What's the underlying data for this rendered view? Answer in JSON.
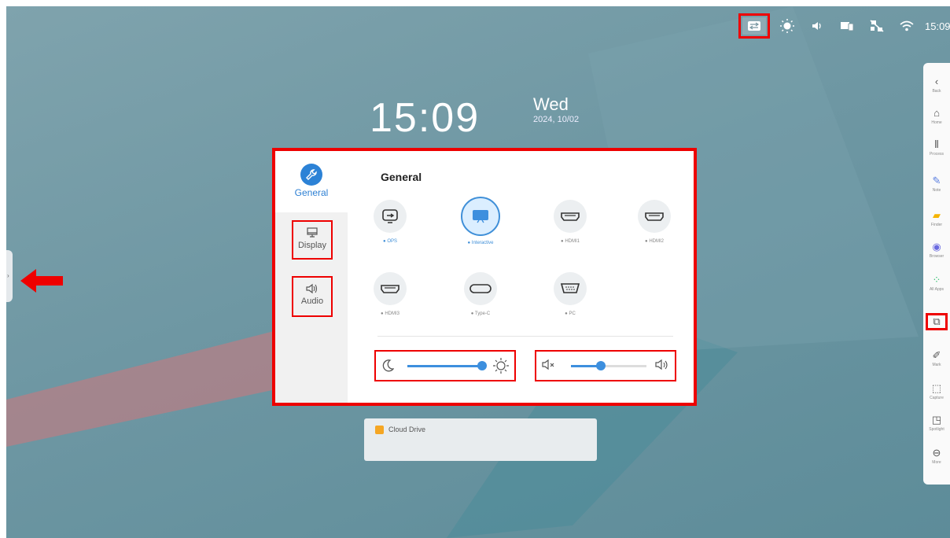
{
  "status_bar": {
    "time": "15:09",
    "icons": [
      "input-switch-icon",
      "brightness-icon",
      "volume-icon",
      "screen-share-icon",
      "network-off-icon",
      "wifi-icon"
    ]
  },
  "clock": {
    "time": "15:09",
    "day": "Wed",
    "date": "2024, 10/02"
  },
  "panel": {
    "title": "General",
    "sidebar": [
      {
        "label": "General",
        "icon": "wrench-icon",
        "active": true
      },
      {
        "label": "Display",
        "icon": "monitor-icon"
      },
      {
        "label": "Audio",
        "icon": "speaker-icon"
      }
    ],
    "sources": [
      {
        "label": "OPS",
        "icon": "ops-icon"
      },
      {
        "label": "Interactive",
        "icon": "interactive-icon",
        "active": true
      },
      {
        "label": "HDMI1",
        "icon": "hdmi-icon"
      },
      {
        "label": "HDMI2",
        "icon": "hdmi-icon"
      },
      {
        "label": "HDMI3",
        "icon": "hdmi-icon"
      },
      {
        "label": "Type-C",
        "icon": "type-c-icon"
      },
      {
        "label": "PC",
        "icon": "vga-icon"
      }
    ],
    "brightness_level": 0.97,
    "volume_level": 0.4
  },
  "cloud_card": {
    "label": "Cloud Drive"
  },
  "dock": [
    {
      "label": "Back",
      "icon": "chevron-left-icon"
    },
    {
      "label": "Home",
      "icon": "home-icon"
    },
    {
      "label": "Process",
      "icon": "process-icon"
    },
    {
      "label": "Note",
      "icon": "note-icon"
    },
    {
      "label": "Finder",
      "icon": "folder-icon"
    },
    {
      "label": "Browser",
      "icon": "browser-icon"
    },
    {
      "label": "All Apps",
      "icon": "apps-icon"
    },
    {
      "label": "",
      "icon": "input-source-icon"
    },
    {
      "label": "Mark",
      "icon": "pen-icon"
    },
    {
      "label": "Capture",
      "icon": "capture-icon"
    },
    {
      "label": "Spotlight",
      "icon": "spotlight-icon"
    },
    {
      "label": "More",
      "icon": "more-icon"
    }
  ],
  "colors": {
    "accent": "#3d8fde",
    "highlight": "#e00000",
    "background": "#6e97a3"
  }
}
